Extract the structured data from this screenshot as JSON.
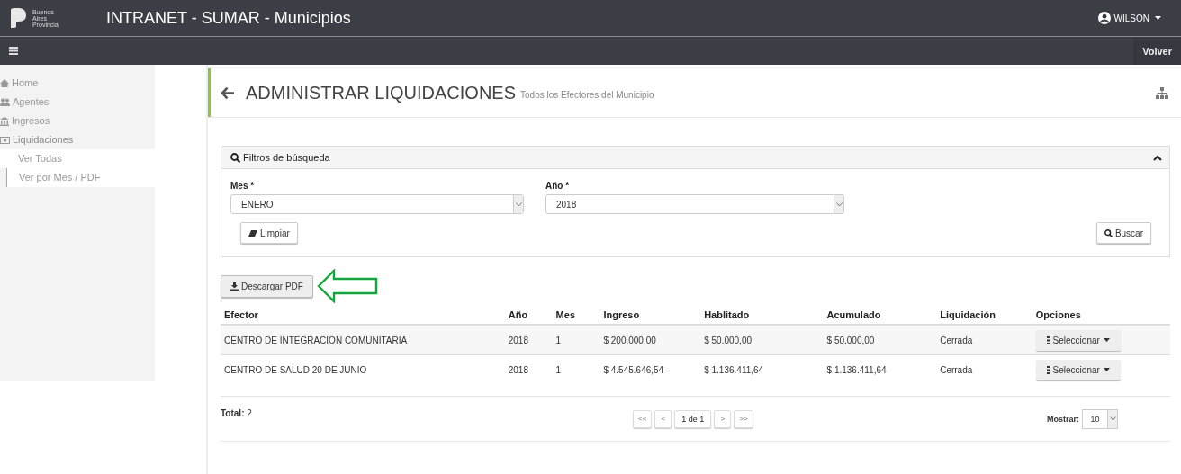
{
  "header": {
    "logo_text": [
      "Buenos",
      "Aires",
      "Provincia"
    ],
    "title": "INTRANET - SUMAR - Municipios",
    "user": "WILSON"
  },
  "subbar": {
    "back": "Volver"
  },
  "sidebar": {
    "items": [
      {
        "label": "Home",
        "selected": false,
        "expanded": false
      },
      {
        "label": "Agentes",
        "selected": false,
        "expanded": false
      },
      {
        "label": "Ingresos",
        "selected": false,
        "expanded": false
      },
      {
        "label": "Liquidaciones",
        "selected": false,
        "expanded": true,
        "children": [
          {
            "label": "Ver Todas",
            "selected": false
          },
          {
            "label": "Ver por Mes / PDF",
            "selected": true
          }
        ]
      }
    ]
  },
  "page": {
    "title": "ADMINISTRAR LIQUIDACIONES",
    "subtitle": "Todos los Efectores del Municipio"
  },
  "filters": {
    "title": "Filtros de búsqueda",
    "expanded": true,
    "fields": [
      {
        "label": "Mes *",
        "value": "ENERO"
      },
      {
        "label": "Año *",
        "value": "2018"
      }
    ],
    "clear": "Limpiar",
    "search": "Buscar"
  },
  "download": "Descargar PDF",
  "table": {
    "columns": [
      "Efector",
      "Año",
      "Mes",
      "Ingreso",
      "Hablitado",
      "Acumulado",
      "Liquidación",
      "Opciones"
    ],
    "rows": [
      [
        "CENTRO DE INTEGRACION COMUNITARIA",
        "2018",
        "1",
        "$ 200.000,00",
        "$ 50.000,00",
        "$ 50.000,00",
        "Cerrada",
        "Seleccionar"
      ],
      [
        "CENTRO DE SALUD 20 DE JUNIO",
        "2018",
        "1",
        "$ 4.545.646,54",
        "$ 1.136.411,64",
        "$ 1.136.411,64",
        "Cerrada",
        "Seleccionar"
      ]
    ]
  },
  "footer": {
    "total": "**Total:** 2",
    "pages": [
      "<<",
      "<",
      "1 de 1",
      ">",
      ">>"
    ],
    "show_label": "Mostrar:",
    "show_value": "10"
  }
}
